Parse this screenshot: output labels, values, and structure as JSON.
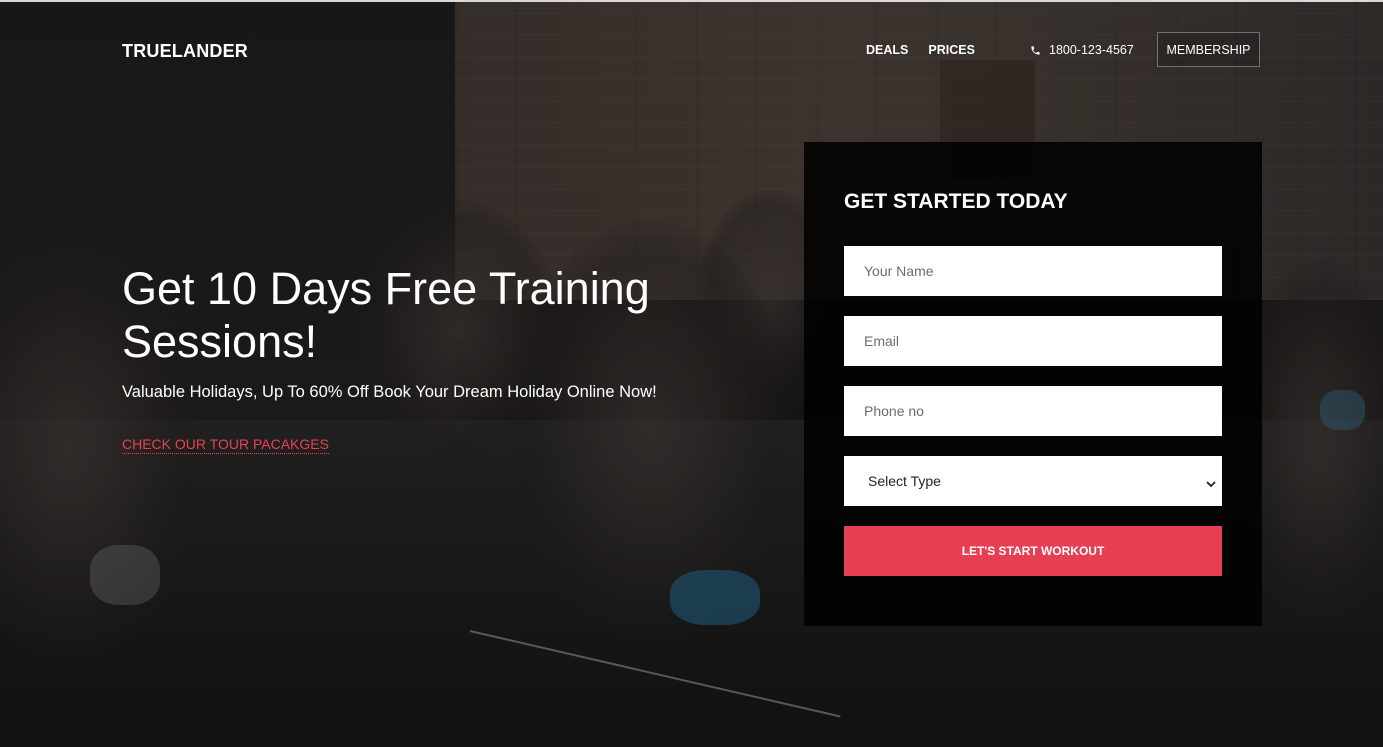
{
  "brand": {
    "name": "TRUELANDER"
  },
  "nav": {
    "items": [
      "DEALS",
      "PRICES"
    ],
    "phone": "1800-123-4567",
    "membership": "MEMBERSHIP"
  },
  "hero": {
    "headline": "Get 10 Days Free Training Sessions!",
    "subline": "Valuable Holidays, Up To 60% Off Book Your Dream Holiday Online Now!",
    "link": "CHECK OUR TOUR PACAKGES"
  },
  "form": {
    "title": "GET STARTED TODAY",
    "name_placeholder": "Your Name",
    "email_placeholder": "Email",
    "phone_placeholder": "Phone no",
    "select_value": "Select Type",
    "submit_label": "LET'S START WORKOUT"
  },
  "colors": {
    "accent": "#e63e52",
    "link": "#e8414f",
    "panel_bg": "#0b0b0b",
    "text": "#ffffff"
  },
  "icons": {
    "phone": "phone-icon",
    "select": "chevron-down-icon"
  }
}
